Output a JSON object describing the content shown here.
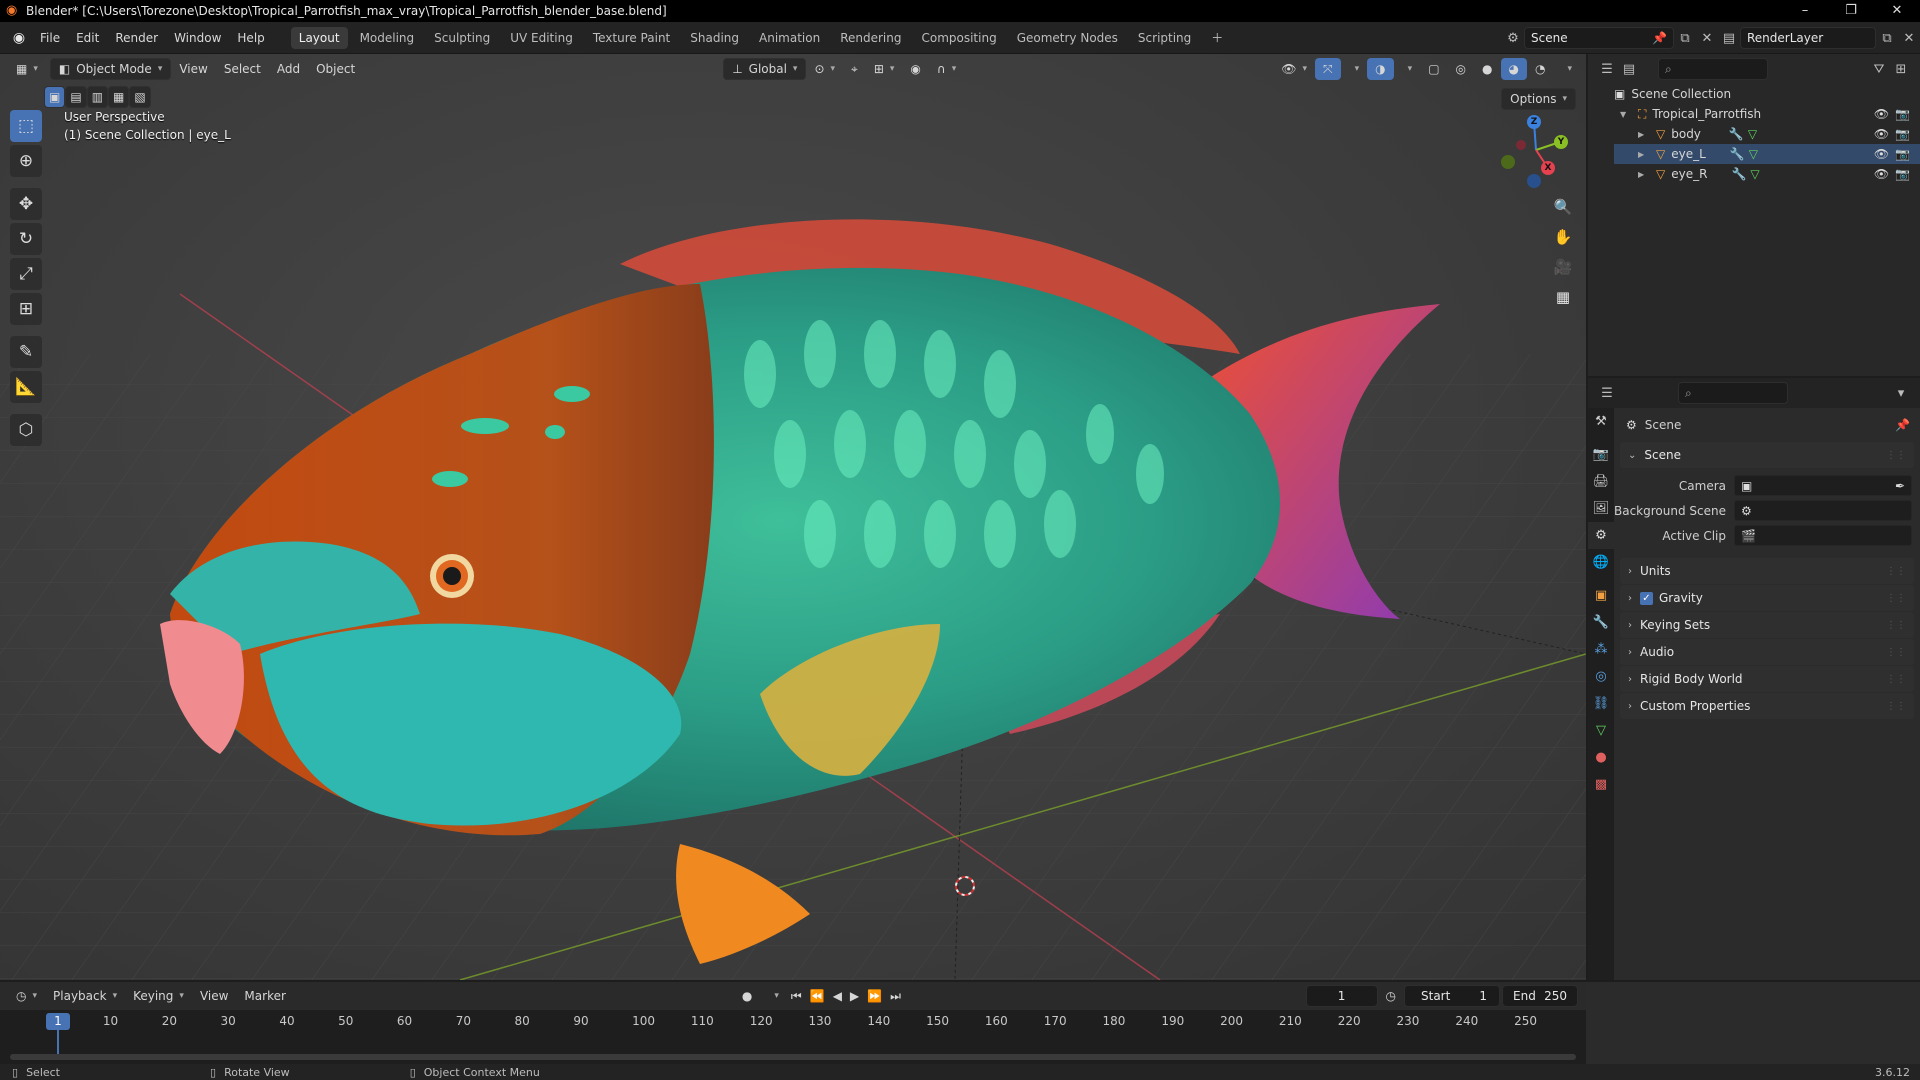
{
  "window": {
    "title": "Blender* [C:\\Users\\Torezone\\Desktop\\Tropical_Parrotfish_max_vray\\Tropical_Parrotfish_blender_base.blend]",
    "controls": [
      "–",
      "❐",
      "✕"
    ]
  },
  "menu": [
    "File",
    "Edit",
    "Render",
    "Window",
    "Help"
  ],
  "workspaces": [
    "Layout",
    "Modeling",
    "Sculpting",
    "UV Editing",
    "Texture Paint",
    "Shading",
    "Animation",
    "Rendering",
    "Compositing",
    "Geometry Nodes",
    "Scripting"
  ],
  "active_workspace": "Layout",
  "scene_name": "Scene",
  "view_layer": "RenderLayer",
  "viewport": {
    "mode": "Object Mode",
    "menus": [
      "View",
      "Select",
      "Add",
      "Object"
    ],
    "transform_orientation": "Global",
    "options_label": "Options",
    "perspective": "User Perspective",
    "context": "(1) Scene Collection | eye_L",
    "gizmo": {
      "z": "Z",
      "y": "Y",
      "x": "X"
    }
  },
  "outliner": {
    "root": "Scene Collection",
    "collection": "Tropical_Parrotfish",
    "objects": [
      "body",
      "eye_L",
      "eye_R"
    ],
    "active_object": "eye_L"
  },
  "properties": {
    "header": "Scene",
    "panel": "Scene",
    "fields": [
      {
        "label": "Camera",
        "value": ""
      },
      {
        "label": "Background Scene",
        "value": ""
      },
      {
        "label": "Active Clip",
        "value": ""
      }
    ],
    "sections": [
      "Units",
      "Gravity",
      "Keying Sets",
      "Audio",
      "Rigid Body World",
      "Custom Properties"
    ],
    "gravity_enabled": true
  },
  "timeline": {
    "menus": [
      "Playback",
      "Keying",
      "View",
      "Marker"
    ],
    "current_frame": "1",
    "start_label": "Start",
    "start": "1",
    "end_label": "End",
    "end": "250",
    "ticks": [
      "10",
      "20",
      "30",
      "40",
      "50",
      "60",
      "70",
      "80",
      "90",
      "100",
      "110",
      "120",
      "130",
      "140",
      "150",
      "160",
      "170",
      "180",
      "190",
      "200",
      "210",
      "220",
      "230",
      "240",
      "250"
    ],
    "playhead": "1"
  },
  "statusbar": {
    "items": [
      "Select",
      "Rotate View",
      "Object Context Menu"
    ],
    "version": "3.6.12"
  },
  "colors": {
    "accent": "#4772b3",
    "blender_orange": "#f5792a",
    "axis_x": "#e5414f",
    "axis_y": "#8ac024",
    "axis_z": "#3b82e0"
  }
}
